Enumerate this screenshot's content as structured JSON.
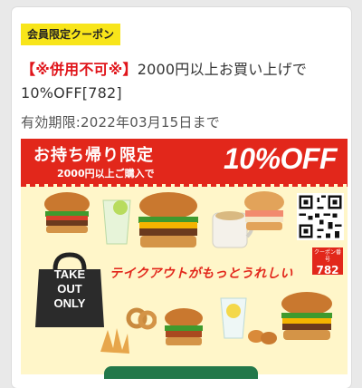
{
  "coupon": {
    "badge": "会員限定クーポン",
    "warning": "【※併用不可※】",
    "title_rest": "2000円以上お買い上げで10%OFF[782]",
    "expiry": "有効期限:2022年03月15日まで"
  },
  "banner": {
    "headline": "お持ち帰り限定",
    "condition": "2000円以上ご購入で",
    "discount": "10%OFF",
    "tagline": "テイクアウトがもっとうれしい",
    "bag_text": [
      "TAKE",
      "OUT",
      "ONLY"
    ],
    "coupon_label": "クーポン番号",
    "coupon_number": "782"
  },
  "colors": {
    "accent_red": "#e2271b",
    "badge_yellow": "#f8e51a",
    "button_green": "#23784a"
  }
}
